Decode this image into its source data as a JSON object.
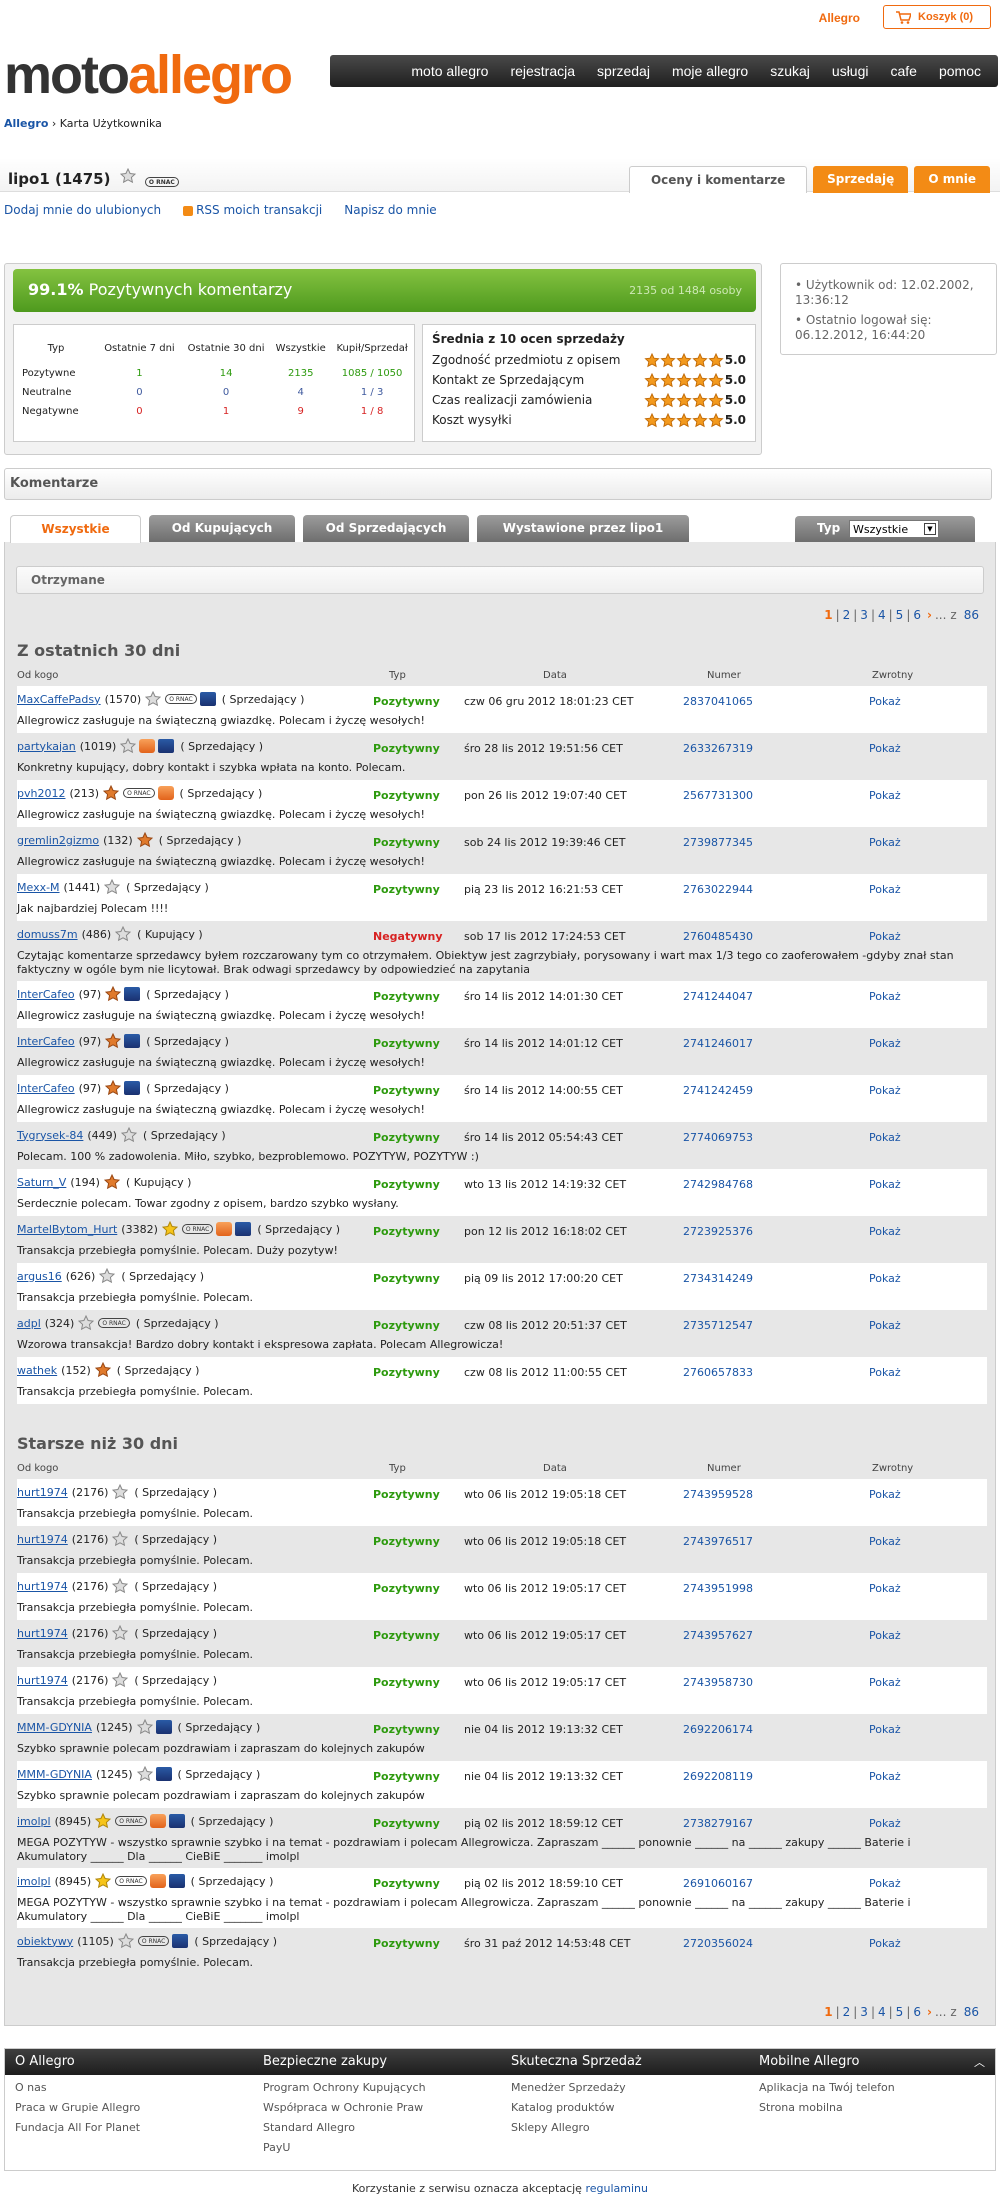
{
  "header": {
    "allegro_link": "Allegro",
    "cart_label": "Koszyk (0)",
    "logo_part1": "moto",
    "logo_part2": "allegro",
    "nav": [
      "moto allegro",
      "rejestracja",
      "sprzedaj",
      "moje allegro",
      "szukaj",
      "usługi",
      "cafe",
      "pomoc"
    ]
  },
  "breadcrumb": {
    "home": "Allegro",
    "sep": "›",
    "current": "Karta Użytkownika"
  },
  "user": {
    "name": "lipo1 (1475)",
    "badge": "O RNAC",
    "tabs": [
      "Oceny i komentarze",
      "Sprzedaję",
      "O mnie"
    ],
    "links": [
      "Dodaj mnie do ulubionych",
      "RSS moich transakcji",
      "Napisz do mnie"
    ]
  },
  "summary": {
    "percent": "99.1%",
    "label": "Pozytywnych komentarzy",
    "count_text": "2135 od 1484 osoby",
    "headers": [
      "Typ",
      "Ostatnie 7 dni",
      "Ostatnie 30 dni",
      "Wszystkie",
      "Kupił/Sprzedał"
    ],
    "rows": [
      {
        "label": "Pozytywne",
        "v": [
          "1",
          "14",
          "2135",
          "1085 / 1050"
        ],
        "cls": "g"
      },
      {
        "label": "Neutralne",
        "v": [
          "0",
          "0",
          "4",
          "1 / 3"
        ],
        "cls": "b"
      },
      {
        "label": "Negatywne",
        "v": [
          "0",
          "1",
          "9",
          "1 / 8"
        ],
        "cls": "r"
      }
    ],
    "avg_title": "Średnia z 10 ocen sprzedaży",
    "avg": [
      {
        "label": "Zgodność przedmiotu z opisem",
        "value": "5.0"
      },
      {
        "label": "Kontakt ze Sprzedającym",
        "value": "5.0"
      },
      {
        "label": "Czas realizacji zamówienia",
        "value": "5.0"
      },
      {
        "label": "Koszt wysyłki",
        "value": "5.0"
      }
    ],
    "rating_stars": 5,
    "info": [
      "Użytkownik od: 12.02.2002, 13:36:12",
      "Ostatnio logował się: 06.12.2012, 16:44:20"
    ]
  },
  "comments": {
    "title": "Komentarze",
    "tabs": [
      "Wszystkie",
      "Od Kupujących",
      "Od Sprzedających",
      "Wystawione przez lipo1"
    ],
    "type_label": "Typ",
    "type_value": "Wszystkie",
    "received": "Otrzymane",
    "pager": {
      "pages": [
        "1",
        "2",
        "3",
        "4",
        "5",
        "6"
      ],
      "dots": "...",
      "z": "z",
      "total": "86",
      "sep": "|"
    },
    "cols": [
      "Od kogo",
      "Typ",
      "Data",
      "Numer",
      "Zwrotny"
    ],
    "section1": "Z ostatnich 30 dni",
    "section2": "Starsze niż 30 dni",
    "recent": [
      {
        "user": "MaxCaffePadsy",
        "score": "(1570)",
        "star": "silver",
        "icons": [
          "pill",
          "blue"
        ],
        "role": "( Sprzedający )",
        "type": "Pozytywny",
        "date": "czw 06 gru 2012 18:01:23 CET",
        "num": "2837041065",
        "ret": "Pokaż",
        "text": "Allegrowicz zasługuje na świąteczną gwiazdkę. Polecam i życzę wesołych!"
      },
      {
        "user": "partykajan",
        "score": "(1019)",
        "star": "silver",
        "icons": [
          "bag",
          "blue"
        ],
        "role": "( Sprzedający )",
        "type": "Pozytywny",
        "date": "śro 28 lis 2012 19:51:56 CET",
        "num": "2633267319",
        "ret": "Pokaż",
        "text": "Konkretny kupujący, dobry kontakt i szybka wpłata na konto. Polecam."
      },
      {
        "user": "pvh2012",
        "score": "(213)",
        "star": "orange",
        "icons": [
          "pill",
          "bag"
        ],
        "role": "( Sprzedający )",
        "type": "Pozytywny",
        "date": "pon 26 lis 2012 19:07:40 CET",
        "num": "2567731300",
        "ret": "Pokaż",
        "text": "Allegrowicz zasługuje na świąteczną gwiazdkę. Polecam i życzę wesołych!"
      },
      {
        "user": "gremlin2gizmo",
        "score": "(132)",
        "star": "orange",
        "icons": [],
        "role": "( Sprzedający )",
        "type": "Pozytywny",
        "date": "sob 24 lis 2012 19:39:46 CET",
        "num": "2739877345",
        "ret": "Pokaż",
        "text": "Allegrowicz zasługuje na świąteczną gwiazdkę. Polecam i życzę wesołych!"
      },
      {
        "user": "Mexx-M",
        "score": "(1441)",
        "star": "silver",
        "icons": [],
        "role": "( Sprzedający )",
        "type": "Pozytywny",
        "date": "pią 23 lis 2012 16:21:53 CET",
        "num": "2763022944",
        "ret": "Pokaż",
        "text": "Jak najbardziej Polecam !!!!"
      },
      {
        "user": "domuss7m",
        "score": "(486)",
        "star": "silver",
        "icons": [],
        "role": "( Kupujący )",
        "type": "Negatywny",
        "date": "sob 17 lis 2012 17:24:53 CET",
        "num": "2760485430",
        "ret": "Pokaż",
        "text": "Czytając komentarze sprzedawcy byłem rozczarowany tym co otrzymałem. Obiektyw jest zagrzybiały, porysowany i wart max 1/3 tego co zaoferowałem -gdyby znał stan faktyczny w ogóle bym nie licytował. Brak odwagi sprzedawcy by odpowiedzieć na zapytania",
        "tall": true
      },
      {
        "user": "InterCafeo",
        "score": "(97)",
        "star": "orange",
        "icons": [
          "blue"
        ],
        "role": "( Sprzedający )",
        "type": "Pozytywny",
        "date": "śro 14 lis 2012 14:01:30 CET",
        "num": "2741244047",
        "ret": "Pokaż",
        "text": "Allegrowicz zasługuje na świąteczną gwiazdkę. Polecam i życzę wesołych!"
      },
      {
        "user": "InterCafeo",
        "score": "(97)",
        "star": "orange",
        "icons": [
          "blue"
        ],
        "role": "( Sprzedający )",
        "type": "Pozytywny",
        "date": "śro 14 lis 2012 14:01:12 CET",
        "num": "2741246017",
        "ret": "Pokaż",
        "text": "Allegrowicz zasługuje na świąteczną gwiazdkę. Polecam i życzę wesołych!"
      },
      {
        "user": "InterCafeo",
        "score": "(97)",
        "star": "orange",
        "icons": [
          "blue"
        ],
        "role": "( Sprzedający )",
        "type": "Pozytywny",
        "date": "śro 14 lis 2012 14:00:55 CET",
        "num": "2741242459",
        "ret": "Pokaż",
        "text": "Allegrowicz zasługuje na świąteczną gwiazdkę. Polecam i życzę wesołych!"
      },
      {
        "user": "Tygrysek-84",
        "score": "(449)",
        "star": "silver",
        "icons": [],
        "role": "( Sprzedający )",
        "type": "Pozytywny",
        "date": "śro 14 lis 2012 05:54:43 CET",
        "num": "2774069753",
        "ret": "Pokaż",
        "text": "Polecam. 100 % zadowolenia. Miło, szybko, bezproblemowo. POZYTYW, POZYTYW :)"
      },
      {
        "user": "Saturn_V",
        "score": "(194)",
        "star": "orange",
        "icons": [],
        "role": "( Kupujący )",
        "type": "Pozytywny",
        "date": "wto 13 lis 2012 14:19:32 CET",
        "num": "2742984768",
        "ret": "Pokaż",
        "text": "Serdecznie polecam. Towar zgodny z opisem, bardzo szybko wysłany."
      },
      {
        "user": "MartelBytom_Hurt",
        "score": "(3382)",
        "star": "gold",
        "icons": [
          "pill",
          "bag",
          "blue"
        ],
        "role": "( Sprzedający )",
        "type": "Pozytywny",
        "date": "pon 12 lis 2012 16:18:02 CET",
        "num": "2723925376",
        "ret": "Pokaż",
        "text": "Transakcja przebiegła pomyślnie. Polecam. Duży pozytyw!"
      },
      {
        "user": "argus16",
        "score": "(626)",
        "star": "silver",
        "icons": [],
        "role": "( Sprzedający )",
        "type": "Pozytywny",
        "date": "pią 09 lis 2012 17:00:20 CET",
        "num": "2734314249",
        "ret": "Pokaż",
        "text": "Transakcja przebiegła pomyślnie. Polecam."
      },
      {
        "user": "adpl",
        "score": "(324)",
        "star": "silver",
        "icons": [
          "pill"
        ],
        "role": "( Sprzedający )",
        "type": "Pozytywny",
        "date": "czw 08 lis 2012 20:51:37 CET",
        "num": "2735712547",
        "ret": "Pokaż",
        "text": "Wzorowa transakcja! Bardzo dobry kontakt i ekspresowa zapłata. Polecam Allegrowicza!"
      },
      {
        "user": "wathek",
        "score": "(152)",
        "star": "orange",
        "icons": [],
        "role": "( Sprzedający )",
        "type": "Pozytywny",
        "date": "czw 08 lis 2012 11:00:55 CET",
        "num": "2760657833",
        "ret": "Pokaż",
        "text": "Transakcja przebiegła pomyślnie. Polecam."
      }
    ],
    "older": [
      {
        "user": "hurt1974",
        "score": "(2176)",
        "star": "silver",
        "icons": [],
        "role": "( Sprzedający )",
        "type": "Pozytywny",
        "date": "wto 06 lis 2012 19:05:18 CET",
        "num": "2743959528",
        "ret": "Pokaż",
        "text": "Transakcja przebiegła pomyślnie. Polecam."
      },
      {
        "user": "hurt1974",
        "score": "(2176)",
        "star": "silver",
        "icons": [],
        "role": "( Sprzedający )",
        "type": "Pozytywny",
        "date": "wto 06 lis 2012 19:05:18 CET",
        "num": "2743976517",
        "ret": "Pokaż",
        "text": "Transakcja przebiegła pomyślnie. Polecam."
      },
      {
        "user": "hurt1974",
        "score": "(2176)",
        "star": "silver",
        "icons": [],
        "role": "( Sprzedający )",
        "type": "Pozytywny",
        "date": "wto 06 lis 2012 19:05:17 CET",
        "num": "2743951998",
        "ret": "Pokaż",
        "text": "Transakcja przebiegła pomyślnie. Polecam."
      },
      {
        "user": "hurt1974",
        "score": "(2176)",
        "star": "silver",
        "icons": [],
        "role": "( Sprzedający )",
        "type": "Pozytywny",
        "date": "wto 06 lis 2012 19:05:17 CET",
        "num": "2743957627",
        "ret": "Pokaż",
        "text": "Transakcja przebiegła pomyślnie. Polecam."
      },
      {
        "user": "hurt1974",
        "score": "(2176)",
        "star": "silver",
        "icons": [],
        "role": "( Sprzedający )",
        "type": "Pozytywny",
        "date": "wto 06 lis 2012 19:05:17 CET",
        "num": "2743958730",
        "ret": "Pokaż",
        "text": "Transakcja przebiegła pomyślnie. Polecam."
      },
      {
        "user": "MMM-GDYNIA",
        "score": "(1245)",
        "star": "silver",
        "icons": [
          "blue"
        ],
        "role": "( Sprzedający )",
        "type": "Pozytywny",
        "date": "nie 04 lis 2012 19:13:32 CET",
        "num": "2692206174",
        "ret": "Pokaż",
        "text": "Szybko sprawnie polecam pozdrawiam i zapraszam do kolejnych zakupów"
      },
      {
        "user": "MMM-GDYNIA",
        "score": "(1245)",
        "star": "silver",
        "icons": [
          "blue"
        ],
        "role": "( Sprzedający )",
        "type": "Pozytywny",
        "date": "nie 04 lis 2012 19:13:32 CET",
        "num": "2692208119",
        "ret": "Pokaż",
        "text": "Szybko sprawnie polecam pozdrawiam i zapraszam do kolejnych zakupów"
      },
      {
        "user": "imolpl",
        "score": "(8945)",
        "star": "gold",
        "icons": [
          "pill",
          "bag",
          "blue"
        ],
        "role": "( Sprzedający )",
        "type": "Pozytywny",
        "date": "pią 02 lis 2012 18:59:12 CET",
        "num": "2738279167",
        "ret": "Pokaż",
        "text": "MEGA POZYTYW - wszystko sprawnie szybko i na temat - pozdrawiam i polecam Allegrowicza. Zapraszam ______ ponownie ______ na ______ zakupy ______ Baterie i Akumulatory ______ Dla ______ CieBiE _______ imolpl",
        "tall": true
      },
      {
        "user": "imolpl",
        "score": "(8945)",
        "star": "gold",
        "icons": [
          "pill",
          "bag",
          "blue"
        ],
        "role": "( Sprzedający )",
        "type": "Pozytywny",
        "date": "pią 02 lis 2012 18:59:10 CET",
        "num": "2691060167",
        "ret": "Pokaż",
        "text": "MEGA POZYTYW - wszystko sprawnie szybko i na temat - pozdrawiam i polecam Allegrowicza. Zapraszam ______ ponownie ______ na ______ zakupy ______ Baterie i Akumulatory ______ Dla ______ CieBiE _______ imolpl",
        "tall": true
      },
      {
        "user": "obiektywy",
        "score": "(1105)",
        "star": "silver",
        "icons": [
          "pill",
          "blue"
        ],
        "role": "( Sprzedający )",
        "type": "Pozytywny",
        "date": "śro 31 paź 2012 14:53:48 CET",
        "num": "2720356024",
        "ret": "Pokaż",
        "text": "Transakcja przebiegła pomyślnie. Polecam."
      }
    ]
  },
  "footer": {
    "cols": [
      {
        "title": "O Allegro",
        "links": [
          "O nas",
          "Praca w Grupie Allegro",
          "Fundacja All For Planet"
        ]
      },
      {
        "title": "Bezpieczne zakupy",
        "links": [
          "Program Ochrony Kupujących",
          "Współpraca w Ochronie Praw",
          "Standard Allegro",
          "PayU"
        ]
      },
      {
        "title": "Skuteczna Sprzedaż",
        "links": [
          "Menedżer Sprzedaży",
          "Katalog produktów",
          "Sklepy Allegro"
        ]
      },
      {
        "title": "Mobilne Allegro",
        "links": [
          "Aplikacja na Twój telefon",
          "Strona mobilna"
        ]
      }
    ],
    "legal_text": "Korzystanie z serwisu oznacza akceptację",
    "legal_link": "regulaminu"
  },
  "colors": {
    "accent": "#f06a0f",
    "positive": "#2d9a0e",
    "negative": "#d72222",
    "link": "#1a55a6"
  }
}
